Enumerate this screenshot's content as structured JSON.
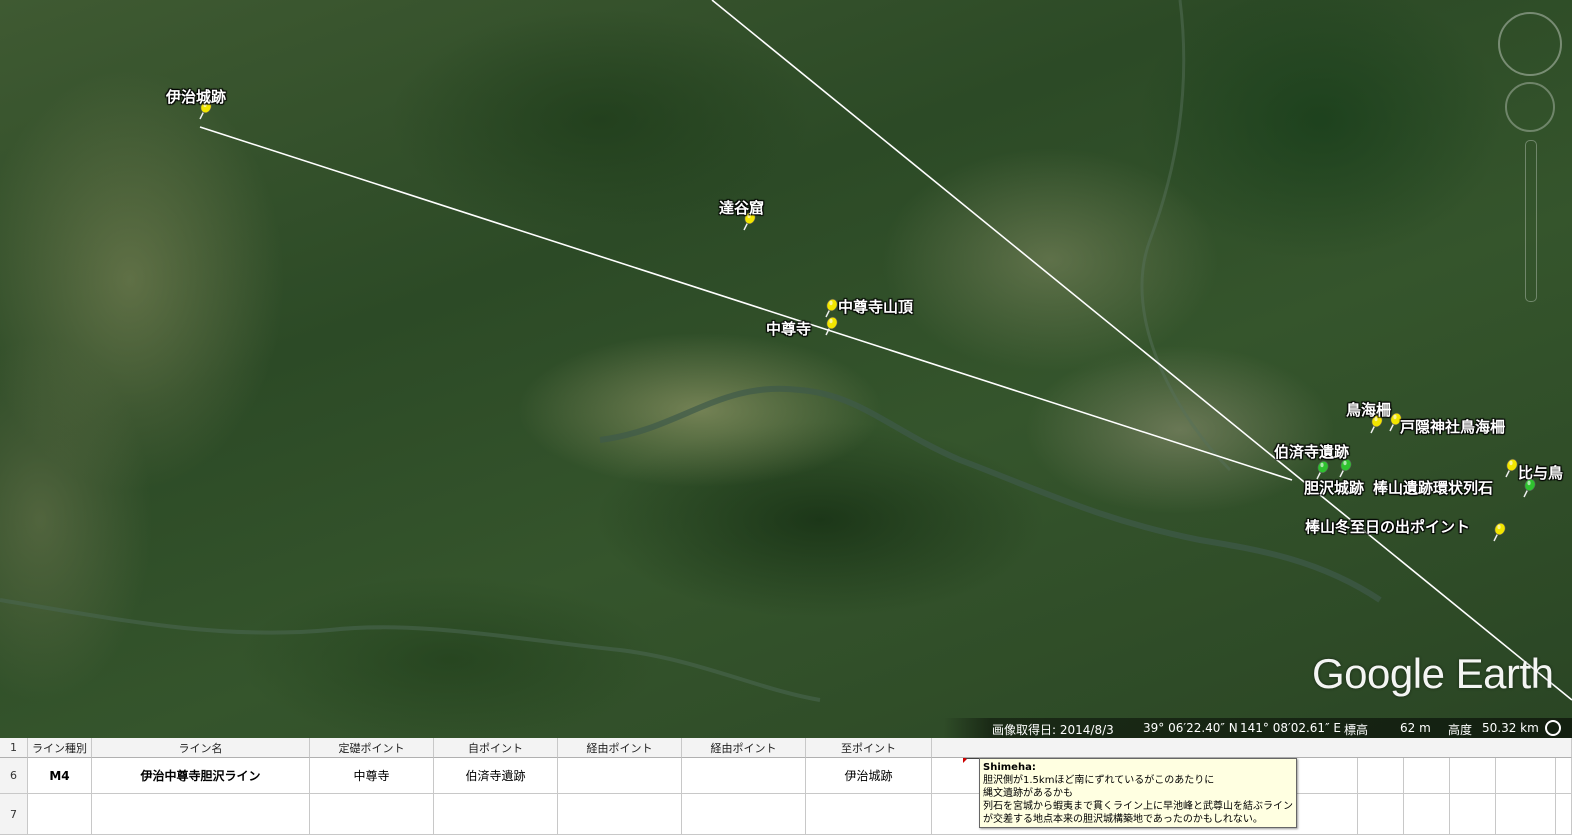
{
  "map": {
    "pins": [
      {
        "id": "iji-castle",
        "label": "伊治城跡",
        "color": "yellow"
      },
      {
        "id": "takkoku-cave",
        "label": "達谷窟",
        "color": "yellow"
      },
      {
        "id": "chusonji-summit",
        "label": "中尊寺山頂",
        "color": "yellow"
      },
      {
        "id": "chusonji",
        "label": "中尊寺",
        "color": "yellow"
      },
      {
        "id": "torinomi-saku",
        "label": "鳥海柵",
        "color": "yellow"
      },
      {
        "id": "togakushi-shrine",
        "label": "戸隠神社鳥海柵",
        "color": "yellow"
      },
      {
        "id": "kudara-ji",
        "label": "伯済寺遺跡",
        "color": "green"
      },
      {
        "id": "hiyotori",
        "label": "比与鳥",
        "color": "yellow"
      },
      {
        "id": "isawa-castle",
        "label": "胆沢城跡",
        "color": "green"
      },
      {
        "id": "bouyama-stones",
        "label": "棒山遺跡環状列石",
        "color": "green"
      },
      {
        "id": "bouyama-sunrise",
        "label": "棒山冬至日の出ポイント",
        "color": "yellow"
      }
    ],
    "watermark": "Google Earth",
    "status": {
      "date_label": "画像取得日: 2014/8/3",
      "latitude": "39° 06′22.40″ N",
      "longitude": "141° 08′02.61″ E",
      "elevation_label": "標高",
      "elevation_value": "62 m",
      "altitude_label": "高度",
      "altitude_value": "50.32 km"
    }
  },
  "sheet": {
    "columns": [
      "ライン種別",
      "ライン名",
      "定礎ポイント",
      "自ポイント",
      "経由ポイント",
      "経由ポイント",
      "至ポイント"
    ],
    "row_numbers": [
      "1",
      "6",
      "7"
    ],
    "rows": [
      [
        "M4",
        "伊治中尊寺胆沢ライン",
        "中尊寺",
        "伯済寺遺跡",
        "",
        "",
        "伊治城跡"
      ],
      [
        "",
        "",
        "",
        "",
        "",
        "",
        ""
      ]
    ],
    "comment": {
      "author": "Shimeha:",
      "lines": [
        "胆沢側が1.5kmほど南にずれているがこのあたりに",
        "縄文遺跡があるかも",
        "列石を宮城から蝦夷まで貫くライン上に早池峰と武尊山を結ぶライン",
        "が交差する地点本来の胆沢城構築地であったのかもしれない。"
      ]
    }
  },
  "colors": {
    "pin_yellow": "#f2e600",
    "pin_green": "#2fc12f",
    "line": "#ffffff",
    "comment_bg": "#ffffe1"
  }
}
